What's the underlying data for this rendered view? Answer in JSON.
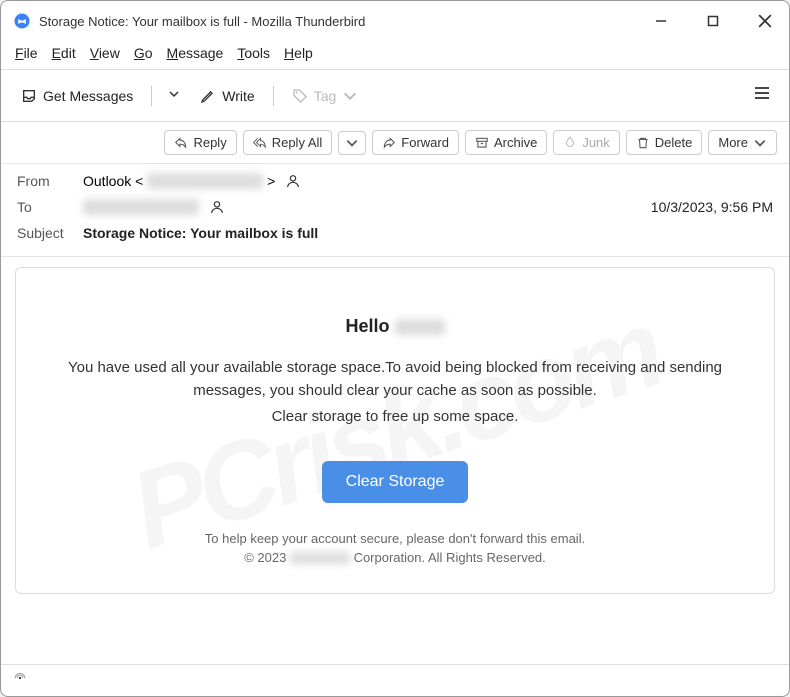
{
  "window": {
    "title": "Storage Notice: Your mailbox is full - Mozilla Thunderbird"
  },
  "menubar": {
    "file": "File",
    "edit": "Edit",
    "view": "View",
    "go": "Go",
    "message": "Message",
    "tools": "Tools",
    "help": "Help"
  },
  "toolbar": {
    "get_messages": "Get Messages",
    "write": "Write",
    "tag": "Tag"
  },
  "actions": {
    "reply": "Reply",
    "reply_all": "Reply All",
    "forward": "Forward",
    "archive": "Archive",
    "junk": "Junk",
    "delete": "Delete",
    "more": "More"
  },
  "headers": {
    "from_label": "From",
    "from_value": "Outlook <",
    "from_close": ">",
    "to_label": "To",
    "subject_label": "Subject",
    "subject_value": "Storage Notice: Your mailbox is full",
    "datetime": "10/3/2023, 9:56 PM"
  },
  "email": {
    "greeting_prefix": "Hello",
    "line1": "You have used all your available storage space.To avoid being blocked from receiving and sending messages, you should clear your cache as soon as possible.",
    "line2": "Clear storage to free up some space.",
    "cta": "Clear Storage",
    "footer1": "To help keep your account secure, please don't forward this email.",
    "footer2a": "© 2023 ",
    "footer2b": " Corporation. All Rights Reserved."
  },
  "watermark": "PCrisk.com"
}
